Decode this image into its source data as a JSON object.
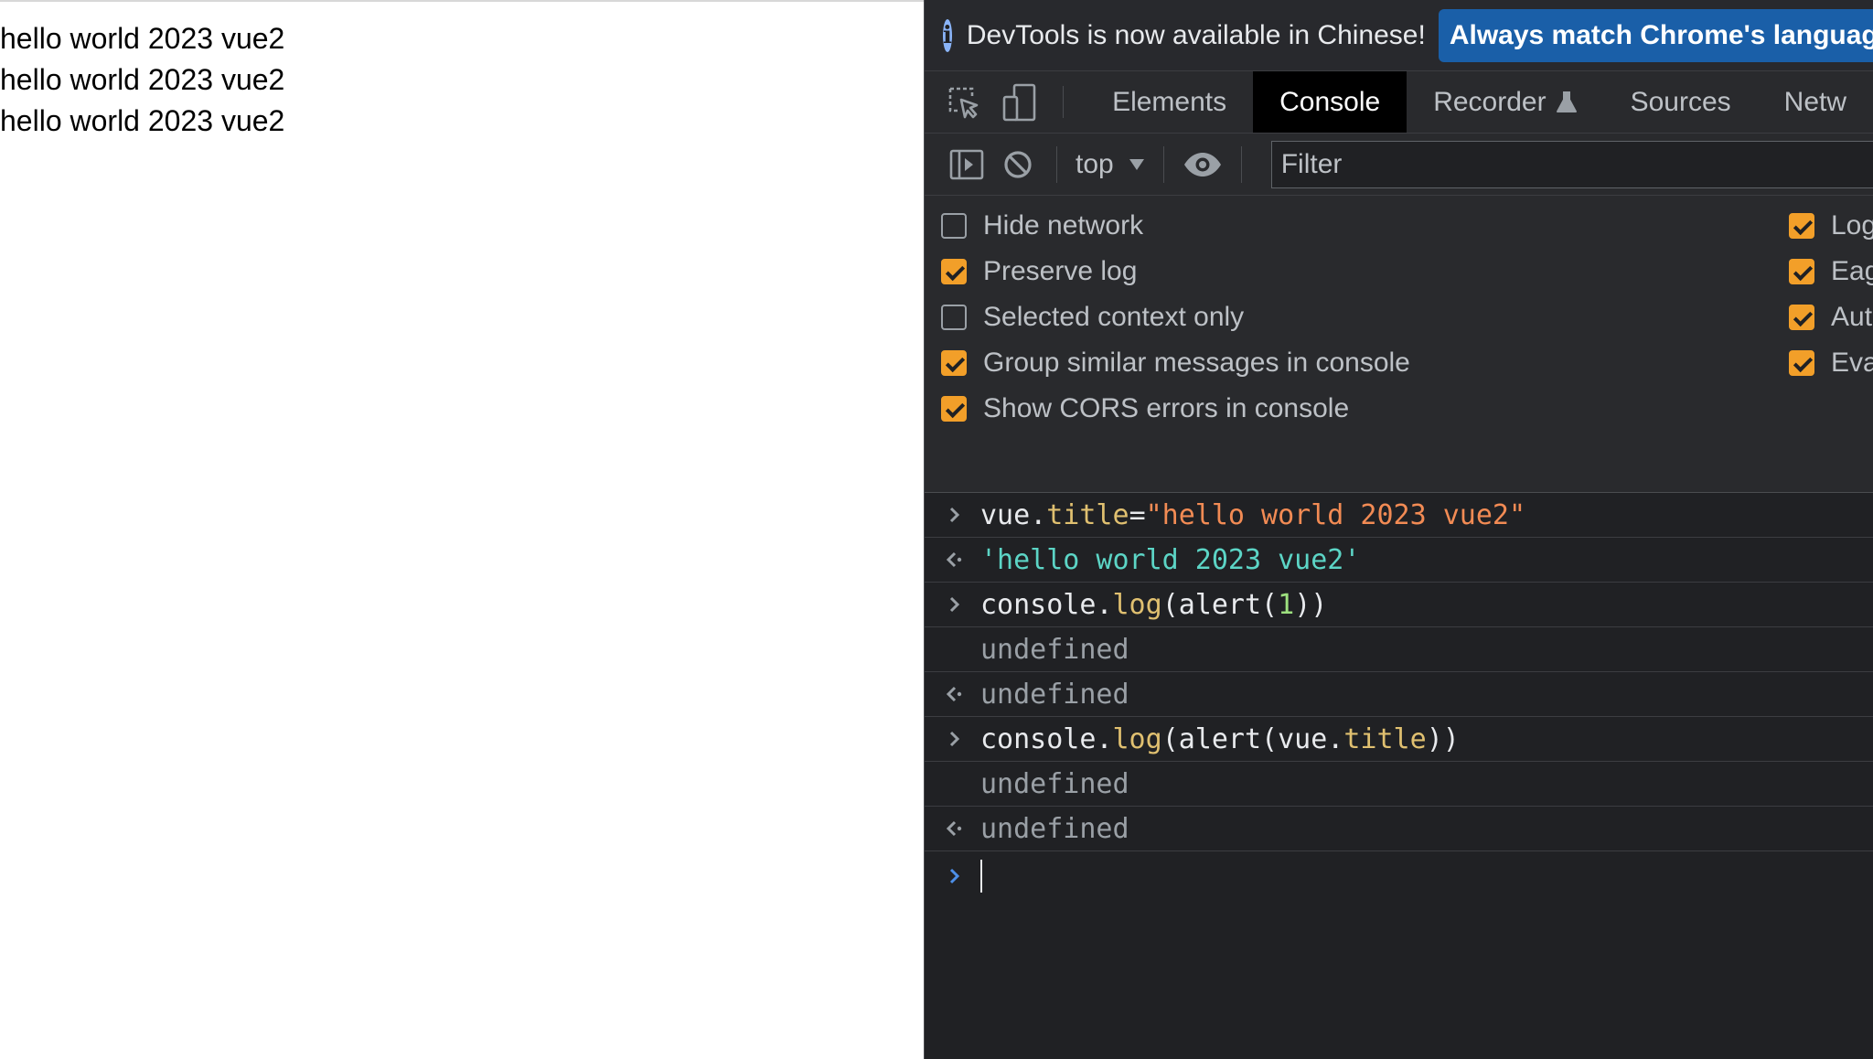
{
  "page": {
    "lines": [
      "hello world 2023 vue2",
      "hello world 2023 vue2",
      "hello world 2023 vue2"
    ]
  },
  "devtools": {
    "infobar": {
      "icon": "info-icon",
      "glyph": "i",
      "message": "DevTools is now available in Chinese!",
      "action": "Always match Chrome's languag"
    },
    "tabs": [
      {
        "label": "Elements",
        "active": false
      },
      {
        "label": "Console",
        "active": true
      },
      {
        "label": "Recorder",
        "active": false,
        "icon": "flask-icon"
      },
      {
        "label": "Sources",
        "active": false
      },
      {
        "label": "Netw",
        "active": false
      }
    ],
    "toolbar": {
      "context": "top",
      "filter_placeholder": "Filter"
    },
    "settings_left": [
      {
        "label": "Hide network",
        "checked": false
      },
      {
        "label": "Preserve log",
        "checked": true
      },
      {
        "label": "Selected context only",
        "checked": false
      },
      {
        "label": "Group similar messages in console",
        "checked": true
      },
      {
        "label": "Show CORS errors in console",
        "checked": true
      }
    ],
    "settings_right": [
      {
        "label": "Log",
        "checked": true
      },
      {
        "label": "Eag",
        "checked": true
      },
      {
        "label": "Aut",
        "checked": true
      },
      {
        "label": "Eva",
        "checked": true
      }
    ],
    "console": {
      "entries": [
        {
          "kind": "input",
          "tokens": [
            {
              "text": "vue",
              "cls": "prop"
            },
            {
              "text": ".",
              "cls": "prop"
            },
            {
              "text": "title",
              "cls": "key"
            },
            {
              "text": "=",
              "cls": "prop"
            },
            {
              "text": "\"hello world 2023 vue2\"",
              "cls": "str"
            }
          ]
        },
        {
          "kind": "result",
          "tokens": [
            {
              "text": "'hello world 2023 vue2'",
              "cls": "res"
            }
          ]
        },
        {
          "kind": "input",
          "tokens": [
            {
              "text": "console",
              "cls": "prop"
            },
            {
              "text": ".",
              "cls": "prop"
            },
            {
              "text": "log",
              "cls": "key"
            },
            {
              "text": "(alert(",
              "cls": "plain"
            },
            {
              "text": "1",
              "cls": "num"
            },
            {
              "text": "))",
              "cls": "plain"
            }
          ]
        },
        {
          "kind": "log",
          "tokens": [
            {
              "text": "undefined",
              "cls": "undef"
            }
          ]
        },
        {
          "kind": "result",
          "tokens": [
            {
              "text": "undefined",
              "cls": "undef"
            }
          ]
        },
        {
          "kind": "input",
          "tokens": [
            {
              "text": "console",
              "cls": "prop"
            },
            {
              "text": ".",
              "cls": "prop"
            },
            {
              "text": "log",
              "cls": "key"
            },
            {
              "text": "(alert(vue.",
              "cls": "plain"
            },
            {
              "text": "title",
              "cls": "key"
            },
            {
              "text": "))",
              "cls": "plain"
            }
          ]
        },
        {
          "kind": "log",
          "tokens": [
            {
              "text": "undefined",
              "cls": "undef"
            }
          ]
        },
        {
          "kind": "result",
          "tokens": [
            {
              "text": "undefined",
              "cls": "undef"
            }
          ]
        }
      ]
    },
    "colors": {
      "accent_checkbox": "#f29f29",
      "info_button": "#1a5fa8",
      "panel_bg": "#202124"
    }
  }
}
